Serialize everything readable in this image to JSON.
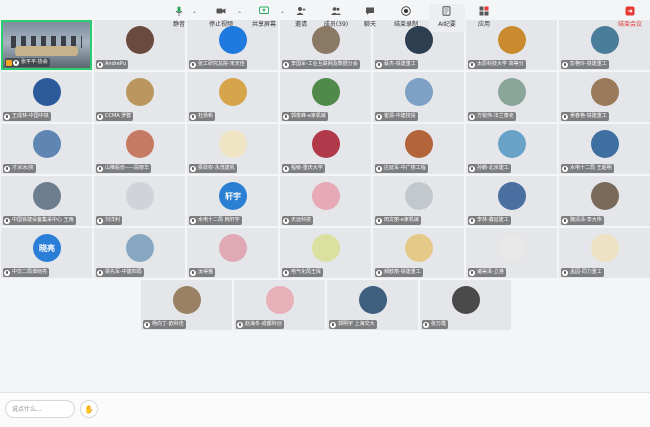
{
  "participants": [
    {
      "name": "张平平-协会",
      "type": "video",
      "host": true
    },
    {
      "name": "AndrePu",
      "color": "#6a4a3c"
    },
    {
      "name": "张工研究总院-宋天佳",
      "color": "#1f7ae0"
    },
    {
      "name": "李国军-工业互联网及数据分会",
      "color": "#8a7a65"
    },
    {
      "name": "蔡杰-铁建重工",
      "color": "#2c3e50"
    },
    {
      "name": "太原科技大学 高等分",
      "color": "#c98b2e"
    },
    {
      "name": "彭艳玲-铁建重工",
      "color": "#4a7d9a"
    },
    {
      "name": "王成林-中国中铁",
      "color": "#2c5a9a"
    },
    {
      "name": "CCMA 罗群",
      "color": "#b9965d"
    },
    {
      "name": "杜扬帆",
      "color": "#d6a44a"
    },
    {
      "name": "郭俊峰-e家机械",
      "color": "#4f8a4a"
    },
    {
      "name": "崔源-中建技投",
      "color": "#7da0c4"
    },
    {
      "name": "方锐伟-法兰泰克",
      "color": "#8aa59a"
    },
    {
      "name": "吴春艳-铁建重工",
      "color": "#9a7a5a"
    },
    {
      "name": "才冰冰/资",
      "color": "#5f86b3"
    },
    {
      "name": "山推股份-----段晓华",
      "color": "#c77a63"
    },
    {
      "name": "侯政权-永茂建机",
      "color": "#efe4c3"
    },
    {
      "name": "程敏-重庆大学",
      "color": "#b03a4a"
    },
    {
      "name": "庄延军-中广核工程",
      "color": "#b3643a"
    },
    {
      "name": "孙鹏-北京建工",
      "color": "#6aa1c7"
    },
    {
      "name": "水电十二局 王超明",
      "color": "#3d6fa1"
    },
    {
      "name": "中国铁建设备集采中心 王雨",
      "color": "#6d7f8f"
    },
    {
      "name": "刘洋利",
      "color": "#d0d3d8"
    },
    {
      "name": "水电十二局 韩轩宇",
      "color": "#2a7fd2",
      "text": "轩宇"
    },
    {
      "name": "天远科技",
      "color": "#e7a9b6"
    },
    {
      "name": "田文丽-e家机械",
      "color": "#c2c8cc"
    },
    {
      "name": "李林-鑫延建工",
      "color": "#4a6fa0"
    },
    {
      "name": "魏清清-李大伟",
      "color": "#7a6a5a"
    },
    {
      "name": "中交二局谭晓亮",
      "color": "#2b7ed8",
      "text": "晓亮"
    },
    {
      "name": "梁先军-中建四局",
      "color": "#8aa7c1"
    },
    {
      "name": "汝得猫",
      "color": "#e0a9b4"
    },
    {
      "name": "电气化局王挥",
      "color": "#d9e0a0"
    },
    {
      "name": "郝欧丽-铁建重工",
      "color": "#e5c988"
    },
    {
      "name": "诸昊泽-立港",
      "color": "#e8e8e8"
    },
    {
      "name": "孟园-同力重工",
      "color": "#ede2c4"
    },
    {
      "name": "杨向丁-欧科佳",
      "color": "#9a8064"
    },
    {
      "name": "赵海冬-成都科创",
      "color": "#e8b0b8"
    },
    {
      "name": "郭明宇 上海交大",
      "color": "#3f5f7f"
    },
    {
      "name": "张万霞",
      "color": "#4a4a4a"
    }
  ],
  "toolbar": {
    "chat_placeholder": "说点什么...",
    "mute": "静音",
    "stop_video": "停止视频",
    "share": "共享屏幕",
    "invite": "邀请",
    "members": "成员(39)",
    "chat": "聊天",
    "record": "结束录制",
    "ai": "AI纪要",
    "apps": "应用",
    "end": "结束会议"
  },
  "colors": {
    "speaking": "#2ecc71",
    "end": "#e53935",
    "accent": "#1f7ae0"
  }
}
